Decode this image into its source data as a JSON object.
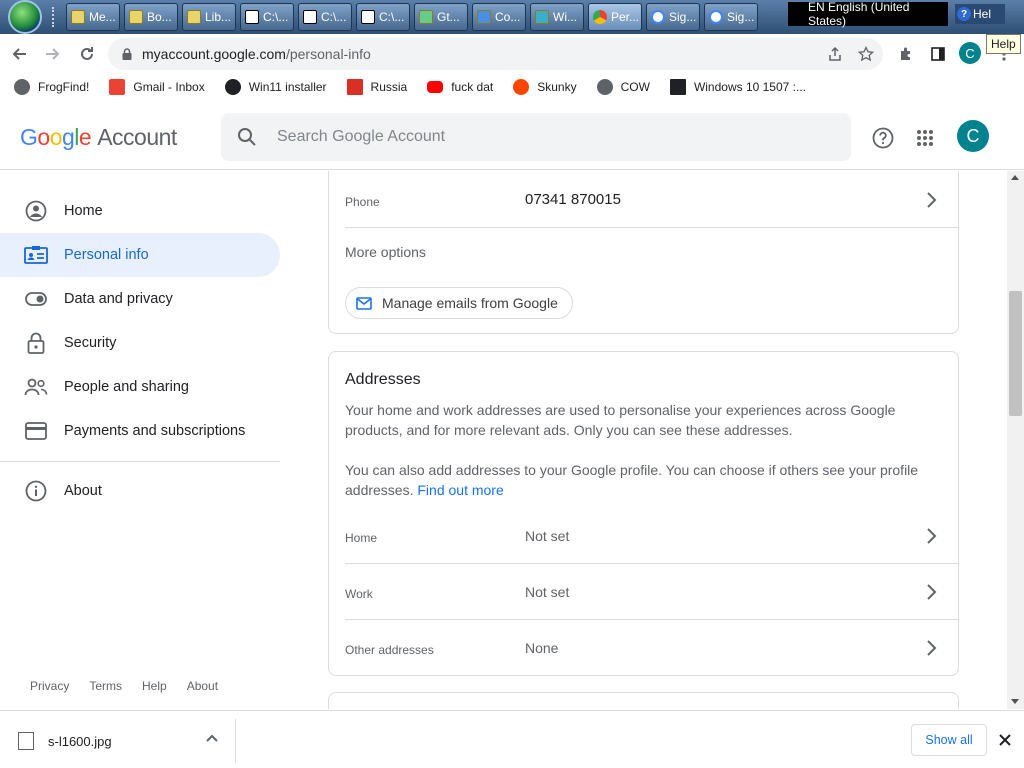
{
  "taskbar": {
    "buttons": [
      {
        "label": "Me...",
        "icon": "folder-icon"
      },
      {
        "label": "Bo...",
        "icon": "folder-icon"
      },
      {
        "label": "Lib...",
        "icon": "libraries-icon"
      },
      {
        "label": "C:\\...",
        "icon": "7zip-icon"
      },
      {
        "label": "C:\\...",
        "icon": "7zip-icon"
      },
      {
        "label": "C:\\...",
        "icon": "7zip-icon"
      },
      {
        "label": "Gt...",
        "icon": "app-icon"
      },
      {
        "label": "Co...",
        "icon": "app-icon"
      },
      {
        "label": "Wi...",
        "icon": "app-icon"
      },
      {
        "label": "Per...",
        "icon": "chrome-icon"
      },
      {
        "label": "Sig...",
        "icon": "google-icon"
      },
      {
        "label": "Sig...",
        "icon": "google-icon"
      }
    ],
    "language": "EN English (United States)",
    "help_button": "Hel",
    "tooltip": "Help"
  },
  "browser": {
    "url_host": "myaccount.google.com",
    "url_path": "/personal-info",
    "profile_letter": "C"
  },
  "bookmarks": [
    {
      "label": "FrogFind!",
      "color": "#5f6368"
    },
    {
      "label": "Gmail - Inbox",
      "color": "#ea4335"
    },
    {
      "label": "Win11 installer",
      "color": "#202124"
    },
    {
      "label": "Russia",
      "color": "#d93025"
    },
    {
      "label": "fuck dat",
      "color": "#ff0000"
    },
    {
      "label": "Skunky",
      "color": "#ff4500"
    },
    {
      "label": "COW",
      "color": "#5f6368"
    },
    {
      "label": "Windows 10 1507 :...",
      "color": "#202124"
    }
  ],
  "header": {
    "logo_google": "Google",
    "logo_account": "Account",
    "search_placeholder": "Search Google Account",
    "avatar_letter": "C"
  },
  "sidebar": {
    "items": [
      {
        "label": "Home"
      },
      {
        "label": "Personal info"
      },
      {
        "label": "Data and privacy"
      },
      {
        "label": "Security"
      },
      {
        "label": "People and sharing"
      },
      {
        "label": "Payments and subscriptions"
      },
      {
        "label": "About"
      }
    ],
    "footer": [
      "Privacy",
      "Terms",
      "Help",
      "About"
    ]
  },
  "contact_card": {
    "phone_label": "Phone",
    "phone_value": "07341 870015",
    "more_options": "More options",
    "manage_emails": "Manage emails from Google"
  },
  "addresses_card": {
    "title": "Addresses",
    "text1": "Your home and work addresses are used to personalise your experiences across Google products, and for more relevant ads. Only you can see these addresses.",
    "text2": "You can also add addresses to your Google profile. You can choose if others see your profile addresses.",
    "find_out_more": "Find out more",
    "rows": [
      {
        "label": "Home",
        "value": "Not set"
      },
      {
        "label": "Work",
        "value": "Not set"
      },
      {
        "label": "Other addresses",
        "value": "None"
      }
    ]
  },
  "downloads": {
    "file": "s-l1600.jpg",
    "show_all": "Show all"
  },
  "colors": {
    "accent": "#1a73e8",
    "selected_bg": "#e8f0fe",
    "avatar": "#00838f"
  }
}
